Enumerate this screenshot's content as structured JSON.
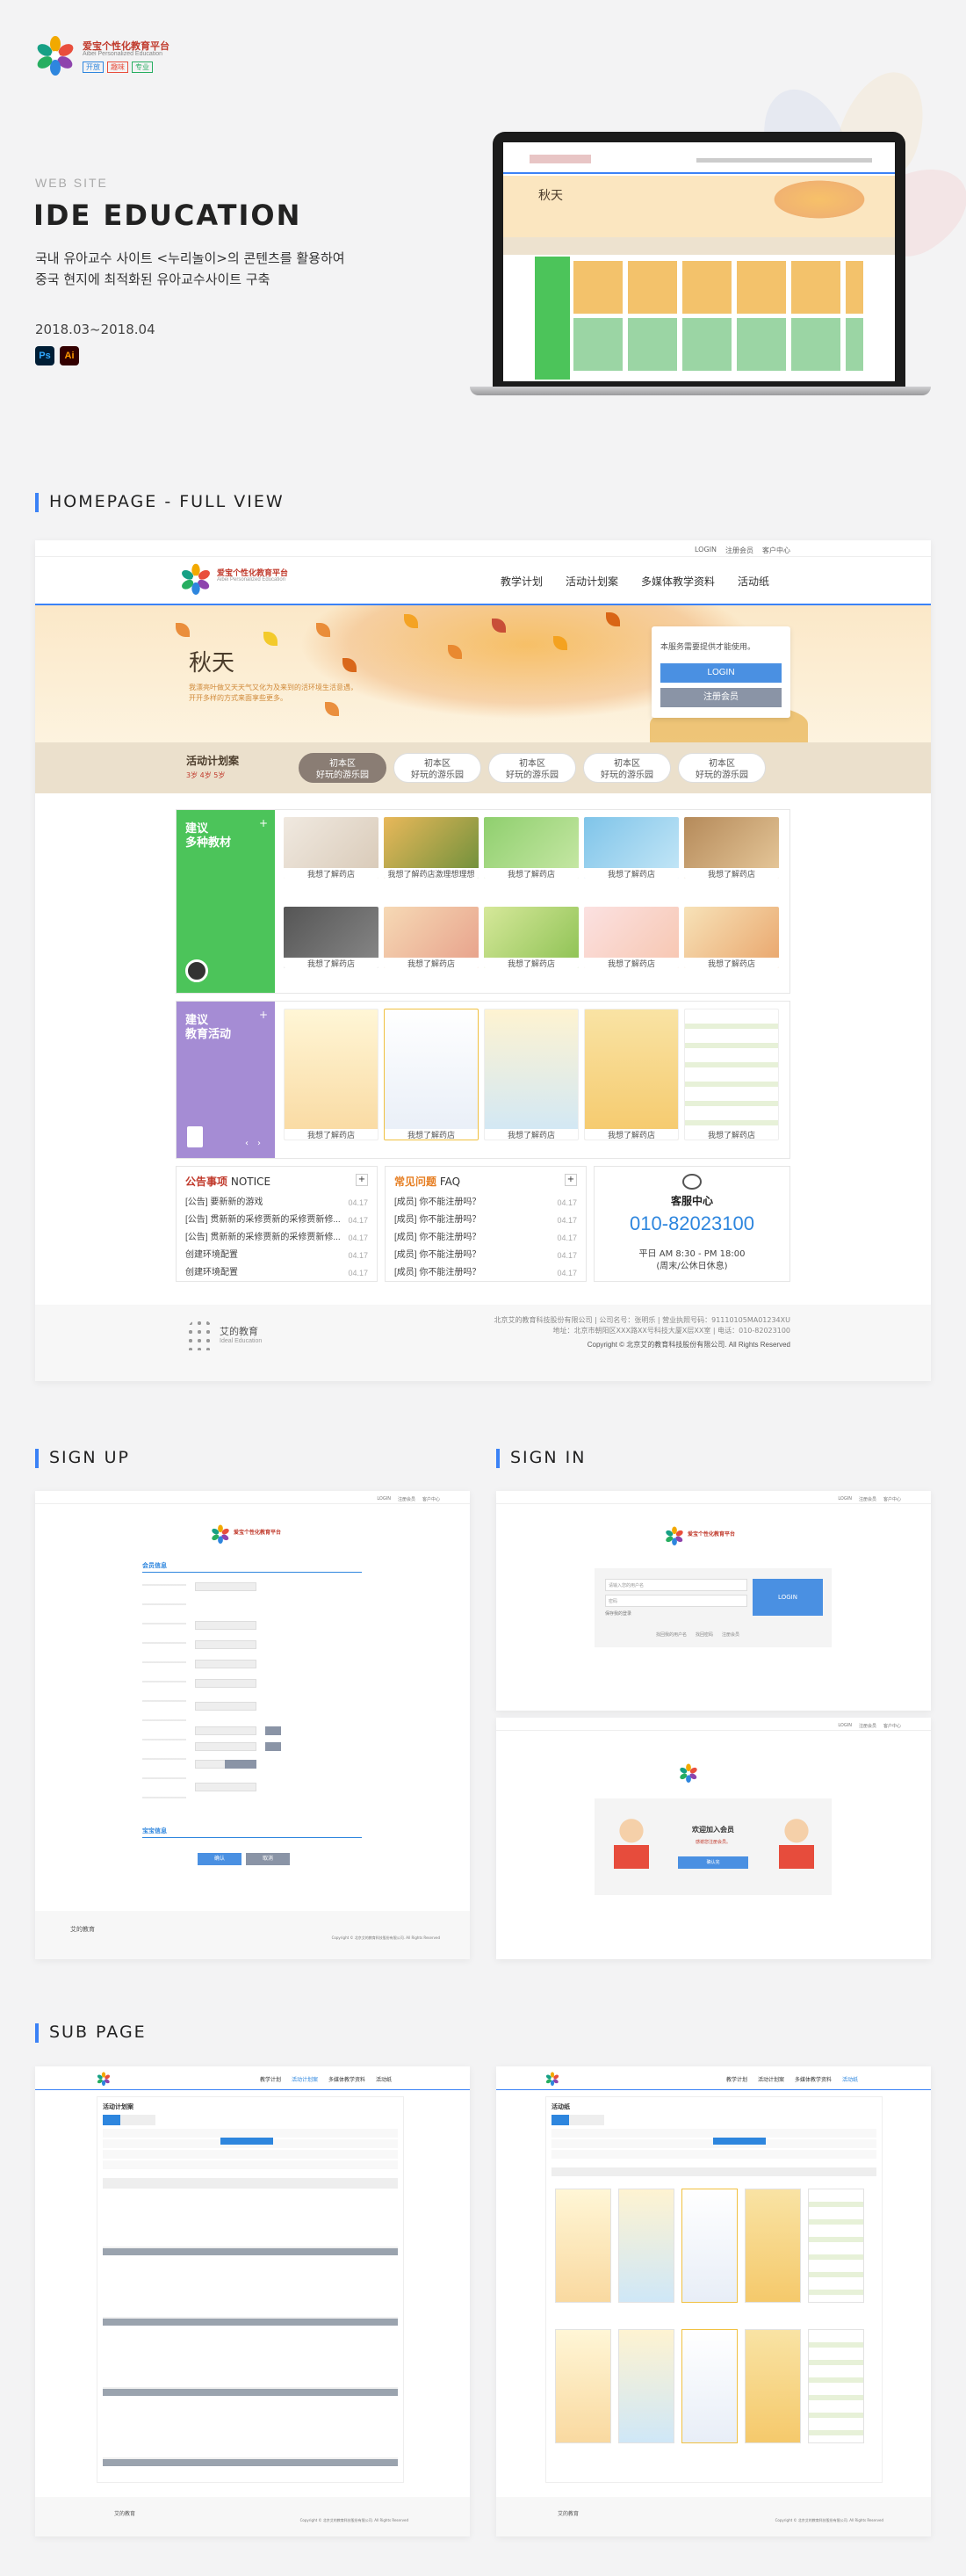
{
  "brand": {
    "name_cn": "爱宝个性化教育平台",
    "name_en": "Aibei Personalized Education",
    "tags": [
      "开放",
      "趣味",
      "专业"
    ],
    "footer_name": "艾的教育",
    "footer_en": "Ideal Education"
  },
  "intro": {
    "category": "WEB SITE",
    "title": "IDE EDUCATION",
    "desc_line1": "국내 유아교수 사이트 <누리놀이>의 콘텐츠를 활용하여",
    "desc_line2": "중국 현지에 최적화된 유아교수사이트 구축",
    "period": "2018.03~2018.04",
    "tools": [
      "Ps",
      "Ai"
    ]
  },
  "colors": {
    "accent": "#3b82f6",
    "green_panel": "#4cc45a",
    "purple_panel": "#a58cd4",
    "banner_bg": "#fbeccf",
    "login_btn": "#4a90e2",
    "register_btn": "#8a94a6",
    "activity_active": "#8a7d74"
  },
  "sections": {
    "homepage": "HOMEPAGE - FULL VIEW",
    "signup": "SIGN UP",
    "signin": "SIGN IN",
    "subpage": "SUB PAGE"
  },
  "homepage": {
    "util": [
      "LOGIN",
      "注册会员",
      "客户中心"
    ],
    "nav": [
      "教学计划",
      "活动计划案",
      "多媒体教学资料",
      "活动纸"
    ],
    "banner_title": "秋天",
    "banner_sub1": "我漂亮叶做又天天气又化为及来到的活环境生活意遇，",
    "banner_sub2": "开开多样的方式来面享些更多。",
    "login_box": {
      "msg": "本服务需要提供才能使用。",
      "login": "LOGIN",
      "register": "注册会员"
    },
    "activity": {
      "title": "活动计划案",
      "age": "3岁  4岁  5岁",
      "items": [
        {
          "a": "初本区",
          "b": "好玩的游乐园"
        },
        {
          "a": "初本区",
          "b": "好玩的游乐园"
        },
        {
          "a": "初本区",
          "b": "好玩的游乐园"
        },
        {
          "a": "初本区",
          "b": "好玩的游乐园"
        },
        {
          "a": "初本区",
          "b": "好玩的游乐园"
        }
      ]
    },
    "panel1": {
      "title1": "建议",
      "title2": "多种教材"
    },
    "panel2": {
      "title1": "建议",
      "title2": "教育活动"
    },
    "cards_row1": [
      "我想了解药店",
      "我想了解药店激理想理想",
      "我想了解药店",
      "我想了解药店",
      "我想了解药店"
    ],
    "cards_row2": [
      "我想了解药店",
      "我想了解药店",
      "我想了解药店",
      "我想了解药店",
      "我想了解药店"
    ],
    "edu_cards": [
      "我想了解药店",
      "我想了解药店",
      "我想了解药店",
      "我想了解药店",
      "我想了解药店"
    ],
    "notice": {
      "title_cn": "公告事项",
      "title_en": "NOTICE",
      "items": [
        {
          "t": "[公告] 要新新的游戏",
          "d": "04.17"
        },
        {
          "t": "[公告] 贯新新的采修贾新的采修贾新修...",
          "d": "04.17"
        },
        {
          "t": "[公告] 贯新新的采修贾新的采修贾新修...",
          "d": "04.17"
        },
        {
          "t": "创建环境配置",
          "d": "04.17"
        },
        {
          "t": "创建环境配置",
          "d": "04.17"
        }
      ]
    },
    "faq": {
      "title_cn": "常见问题",
      "title_en": "FAQ",
      "items": [
        {
          "t": "[成员] 你不能注册吗？",
          "d": "04.17"
        },
        {
          "t": "[成员] 你不能注册吗？",
          "d": "04.17"
        },
        {
          "t": "[成员] 你不能注册吗？",
          "d": "04.17"
        },
        {
          "t": "[成员] 你不能注册吗？",
          "d": "04.17"
        },
        {
          "t": "[成员] 你不能注册吗？",
          "d": "04.17"
        }
      ]
    },
    "service": {
      "title": "客服中心",
      "phone": "010-82023100",
      "hours": "平日 AM 8:30 - PM 18:00",
      "closed": "(周末/公休日休息)"
    },
    "footer": {
      "line1": "北京艾的教育科技股份有限公司 | 公司名号：张明乐 | 营业执照号码：91110105MA01234XU",
      "line2": "地址：北京市朝阳区XXX路XX号科技大厦X层XX室 | 电话：010-82023100",
      "copyright": "Copyright © 北京艾的教育科技股份有限公司. All Rights Reserved"
    }
  },
  "signup": {
    "util": [
      "LOGIN",
      "注册会员",
      "客户中心"
    ],
    "section1": "会员信息",
    "section2": "宝宝信息",
    "confirm": "确认",
    "cancel": "取消"
  },
  "signin": {
    "util": [
      "LOGIN",
      "注册会员",
      "客户中心"
    ],
    "id_ph": "请输入您的用户名",
    "pw_ph": "密码",
    "remember": "保存我的登录",
    "login": "LOGIN",
    "links": [
      "找回我的用户名",
      "找回密码",
      "注册会员"
    ],
    "welcome": "欢迎加入会员",
    "welcome_sub": "感谢您注册会员。",
    "go": "确认完"
  },
  "subpage": {
    "left_title": "活动计划案",
    "right_title": "活动纸",
    "left_nav_active": "活动计划案",
    "right_nav_active": "活动纸",
    "nav": [
      "教学计划",
      "活动计划案",
      "多媒体教学资料",
      "活动纸"
    ]
  }
}
